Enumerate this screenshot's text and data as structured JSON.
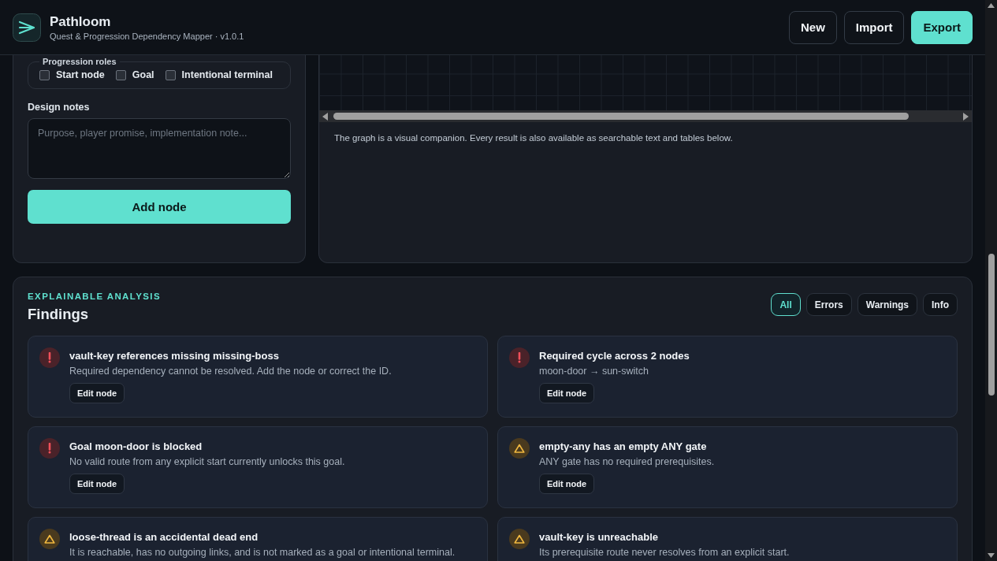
{
  "app": {
    "name": "Pathloom",
    "subtitle": "Quest & Progression Dependency Mapper · v1.0.1"
  },
  "header_buttons": [
    {
      "label": "New",
      "kind": "plain"
    },
    {
      "label": "Import",
      "kind": "plain"
    },
    {
      "label": "Export",
      "kind": "primary"
    }
  ],
  "node_form": {
    "roles_legend": "Progression roles",
    "roles": [
      {
        "label": "Start node",
        "checked": false
      },
      {
        "label": "Goal",
        "checked": false
      },
      {
        "label": "Intentional terminal",
        "checked": false
      }
    ],
    "notes_label": "Design notes",
    "notes_placeholder": "Purpose, player promise, implementation note...",
    "submit": "Add node"
  },
  "graph": {
    "caption": "The graph is a visual companion. Every result is also available as searchable text and tables below."
  },
  "analysis": {
    "eyebrow": "EXPLAINABLE ANALYSIS",
    "title": "Findings",
    "filters": [
      {
        "label": "All",
        "selected": true
      },
      {
        "label": "Errors",
        "selected": false
      },
      {
        "label": "Warnings",
        "selected": false
      },
      {
        "label": "Info",
        "selected": false
      }
    ],
    "findings": [
      {
        "kind": "error",
        "title": "vault-key references missing missing-boss",
        "detail": "Required dependency cannot be resolved. Add the node or correct the ID.",
        "action": "Edit node"
      },
      {
        "kind": "error",
        "title": "Required cycle across 2 nodes",
        "detail": "moon-door → sun-switch",
        "action": "Edit node"
      },
      {
        "kind": "error",
        "title": "Goal moon-door is blocked",
        "detail": "No valid route from any explicit start currently unlocks this goal.",
        "action": "Edit node"
      },
      {
        "kind": "warning",
        "title": "empty-any has an empty ANY gate",
        "detail": "ANY gate has no required prerequisites.",
        "action": "Edit node"
      },
      {
        "kind": "warning",
        "title": "loose-thread is an accidental dead end",
        "detail": "It is reachable, has no outgoing links, and is not marked as a goal or intentional terminal."
      },
      {
        "kind": "warning",
        "title": "vault-key is unreachable",
        "detail": "Its prerequisite route never resolves from an explicit start."
      }
    ]
  }
}
